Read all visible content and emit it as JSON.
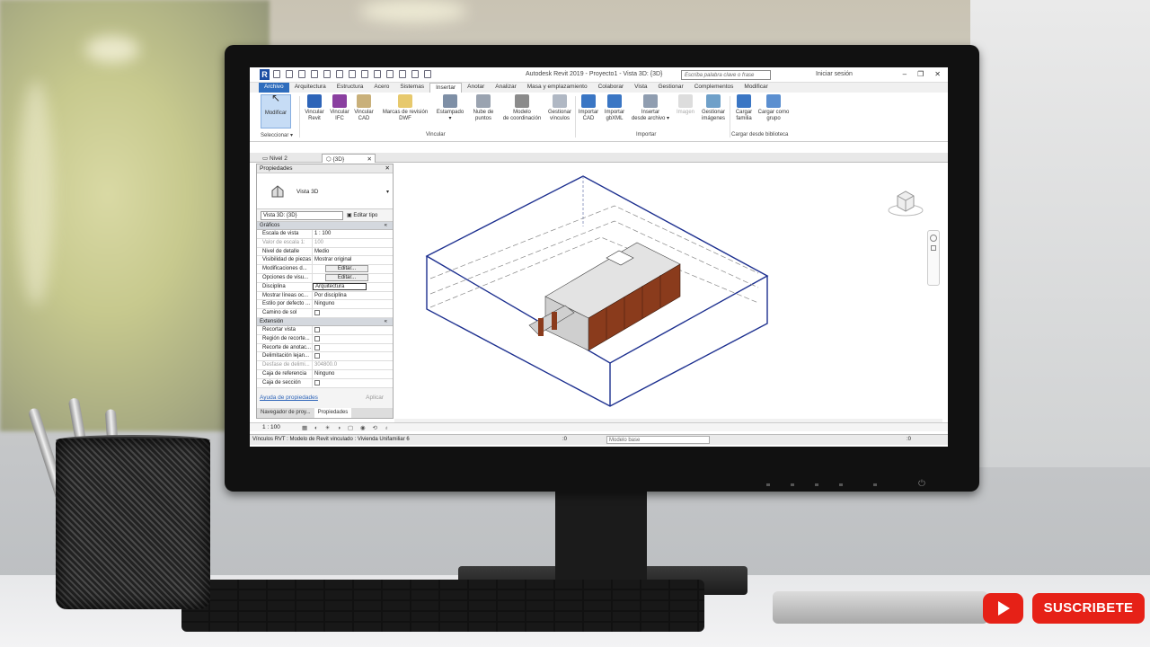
{
  "app": {
    "title": "Autodesk Revit 2019 - Proyecto1 - Vista 3D: {3D}",
    "search_placeholder": "Escriba palabra clave o frase",
    "login": "Iniciar sesión"
  },
  "ribbon_tabs": [
    "Archivo",
    "Arquitectura",
    "Estructura",
    "Acero",
    "Sistemas",
    "Insertar",
    "Anotar",
    "Analizar",
    "Masa y emplazamiento",
    "Colaborar",
    "Vista",
    "Gestionar",
    "Complementos",
    "Modificar"
  ],
  "active_tab": "Insertar",
  "ribbon": {
    "modify": "Modificar",
    "select_label": "Seleccionar ▾",
    "vincular_revit": "Vincular\nRevit",
    "vincular_ifc": "Vincular\nIFC",
    "vincular_cad": "Vincular\nCAD",
    "marcas": "Marcas de revisión\nDWF",
    "estampado": "Estampado\n▾",
    "nube": "Nube de\npuntos",
    "modelo_coord": "Modelo\nde coordinación",
    "gestionar_vinculos": "Gestionar\nvínculos",
    "importar_cad": "Importar\nCAD",
    "importar_gbxml": "Importar\ngbXML",
    "insertar_archivo": "Insertar\ndesde archivo ▾",
    "imagen": "Imagen",
    "gestionar_imagenes": "Gestionar\nimágenes",
    "cargar_familia": "Cargar\nfamilia",
    "cargar_grupo": "Cargar como\ngrupo",
    "group_vincular": "Vincular",
    "group_importar": "Importar",
    "group_cargar": "Cargar desde biblioteca"
  },
  "view_tabs": [
    {
      "label": "Nivel 2"
    },
    {
      "label": "{3D}"
    }
  ],
  "properties": {
    "header": "Propiedades",
    "type_name": "Vista 3D",
    "selector": "Vista 3D: {3D}",
    "edit_type": "Editar tipo",
    "section_graficos": "Gráficos",
    "section_extension": "Extensión",
    "rows_graficos": [
      {
        "k": "Escala de vista",
        "v": "1 : 100"
      },
      {
        "k": "Valor de escala    1:",
        "v": "100"
      },
      {
        "k": "Nivel de detalle",
        "v": "Medio"
      },
      {
        "k": "Visibilidad de piezas",
        "v": "Mostrar original"
      },
      {
        "k": "Modificaciones d...",
        "v": "Editar..."
      },
      {
        "k": "Opciones de visu...",
        "v": "Editar..."
      },
      {
        "k": "Disciplina",
        "v": "Arquitectura"
      },
      {
        "k": "Mostrar líneas oc...",
        "v": "Por disciplina"
      },
      {
        "k": "Estilo por defecto ...",
        "v": "Ninguno"
      },
      {
        "k": "Camino de sol",
        "v": ""
      }
    ],
    "rows_extension": [
      {
        "k": "Recortar vista",
        "v": ""
      },
      {
        "k": "Región de recorte...",
        "v": ""
      },
      {
        "k": "Recorte de anotac...",
        "v": ""
      },
      {
        "k": "Delimitación lejan...",
        "v": ""
      },
      {
        "k": "Desfase de delimi...",
        "v": "304800.0"
      },
      {
        "k": "Caja de referencia",
        "v": "Ninguno"
      },
      {
        "k": "Caja de sección",
        "v": ""
      }
    ],
    "help": "Ayuda de propiedades",
    "apply": "Aplicar",
    "bottom_tabs": [
      "Navegador de proy...",
      "Propiedades"
    ]
  },
  "view_control": {
    "scale": "1 : 100"
  },
  "status": {
    "message": "Vínculos RVT : Modelo de Revit vinculado : Vivienda Unifamiliar 6",
    "zero": ":0",
    "model": "Modelo base",
    "filter": ":0"
  },
  "overlay": {
    "subscribe": "SUSCRIBETE"
  },
  "colors": {
    "accent": "#2f6dbd",
    "youtube": "#e62117",
    "bbox": "#1c2f8f",
    "wall": "#8a3b1c"
  }
}
